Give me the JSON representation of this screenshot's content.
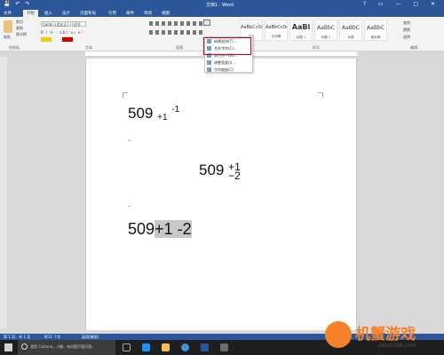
{
  "window": {
    "title": "文档1 - Word",
    "quick_access": "💾 ↶ ↷",
    "window_controls": "? ▭ — ▢ ✕"
  },
  "tabs": [
    {
      "label": "文件"
    },
    {
      "label": "开始"
    },
    {
      "label": "插入"
    },
    {
      "label": "设计"
    },
    {
      "label": "页面布局"
    },
    {
      "label": "引用"
    },
    {
      "label": "邮件"
    },
    {
      "label": "审阅"
    },
    {
      "label": "视图"
    }
  ],
  "ribbon": {
    "clipboard": {
      "paste": "粘贴",
      "cut": "剪切",
      "copy": "复制",
      "format_painter": "格式刷",
      "group": "剪贴板"
    },
    "font": {
      "name": "Calibri (西文正)",
      "size": "初号",
      "group": "字体",
      "buttons": "B I U · abc x₂ x²"
    },
    "paragraph": {
      "group": "段落",
      "chinese_layout_button": "中文版式"
    },
    "styles": {
      "group": "样式",
      "items": [
        {
          "preview": "AaBbCcDd",
          "name": "正文"
        },
        {
          "preview": "AaBbCcDd",
          "name": "无间隔"
        },
        {
          "preview": "AaBl",
          "name": "标题 1"
        },
        {
          "preview": "AaBbC",
          "name": "标题 2"
        },
        {
          "preview": "AaBbC",
          "name": "标题"
        },
        {
          "preview": "AaBbC",
          "name": "副标题"
        }
      ]
    },
    "editing": {
      "find": "查找",
      "replace": "替换",
      "select": "选择",
      "group": "编辑"
    }
  },
  "dropdown": {
    "items": [
      {
        "label": "纵横混排(T)..."
      },
      {
        "label": "合并字符(C)..."
      },
      {
        "label": "双行合一(W)..."
      },
      {
        "label": "调整宽度(I)..."
      },
      {
        "label": "字符缩放(C)"
      }
    ]
  },
  "document": {
    "line1": {
      "base": "509",
      "sub": "+1",
      "sup": "-1"
    },
    "line2": {
      "base": "509",
      "top": "+1",
      "bottom": "−2"
    },
    "line3": {
      "plain": "509",
      "selected": "+1 -2"
    },
    "para_mark": "↵"
  },
  "status": {
    "page": "第 1 页，共 1 页",
    "words": "8/11 个字",
    "lang": "英语(美国)"
  },
  "taskbar": {
    "search_placeholder": "我是 Cortana，小娜。有问题尽管问我。"
  },
  "watermark": {
    "brand": "机蟹游戏",
    "url": "jixie5188.com"
  },
  "colors": {
    "word_blue": "#2b579a",
    "highlight_red": "#d0021b",
    "selection_gray": "#c8c8c8"
  }
}
